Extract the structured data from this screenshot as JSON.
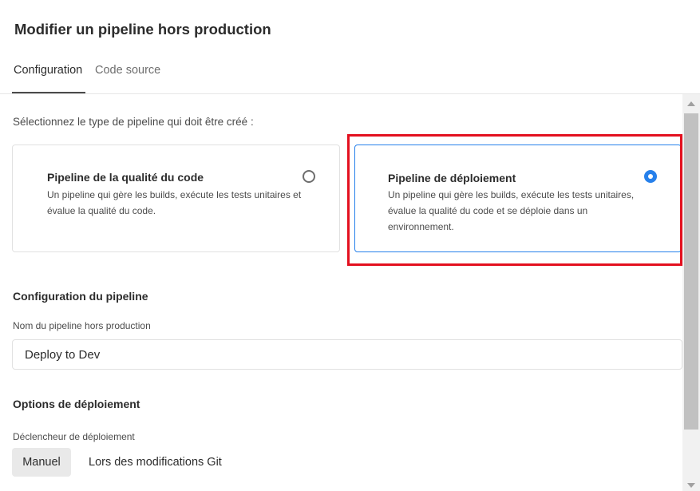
{
  "dialog": {
    "title": "Modifier un pipeline hors production"
  },
  "tabs": [
    {
      "label": "Configuration",
      "active": true
    },
    {
      "label": "Code source",
      "active": false
    }
  ],
  "pipeline_type": {
    "prompt": "Sélectionnez le type de pipeline qui doit être créé :",
    "options": [
      {
        "title": "Pipeline de la qualité du code",
        "description": "Un pipeline qui gère les builds, exécute les tests unitaires et évalue la qualité du code.",
        "selected": false
      },
      {
        "title": "Pipeline de déploiement",
        "description": "Un pipeline qui gère les builds, exécute les tests unitaires, évalue la qualité du code et se déploie dans un environnement.",
        "selected": true
      }
    ]
  },
  "pipeline_config": {
    "heading": "Configuration du pipeline",
    "name_label": "Nom du pipeline hors production",
    "name_value": "Deploy to Dev"
  },
  "deploy_options": {
    "heading": "Options de déploiement",
    "trigger_label": "Déclencheur de déploiement",
    "trigger_options": [
      {
        "label": "Manuel",
        "selected": true
      },
      {
        "label": "Lors des modifications Git",
        "selected": false
      }
    ]
  },
  "colors": {
    "accent": "#2680eb",
    "highlight": "#e3101f"
  }
}
